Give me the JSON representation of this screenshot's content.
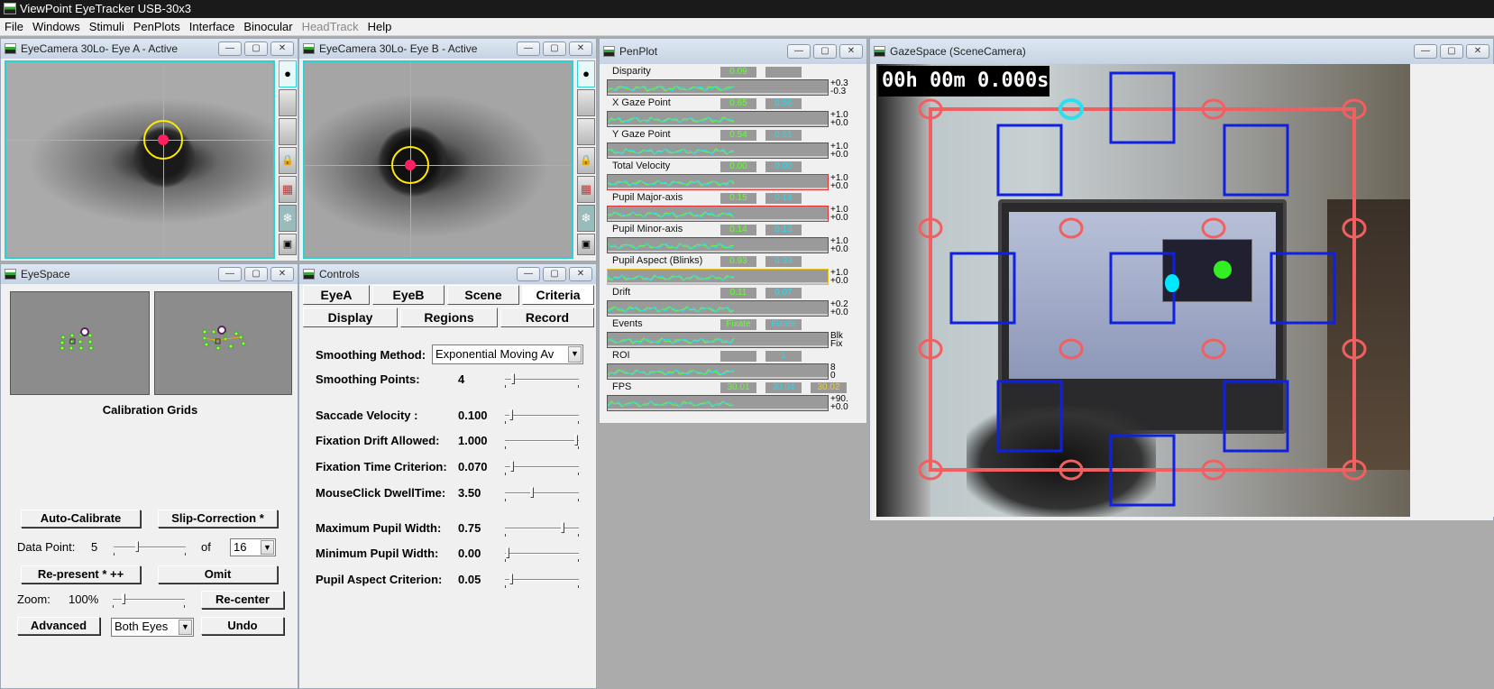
{
  "app": {
    "title": "ViewPoint EyeTracker USB-30x3"
  },
  "menu": [
    "File",
    "Windows",
    "Stimuli",
    "PenPlots",
    "Interface",
    "Binocular",
    "HeadTrack",
    "Help"
  ],
  "colors": {
    "cyan": "#29d3d3",
    "pink": "#ff7fd0",
    "calib_red": "#f06060",
    "roi_blue": "#1020e0",
    "green_trace": "#66ff33"
  },
  "eyecam_a": {
    "title": "EyeCamera 30Lo- Eye A - Active"
  },
  "eyecam_b": {
    "title": "EyeCamera 30Lo- Eye B - Active"
  },
  "eyespace": {
    "title": "EyeSpace",
    "caption": "Calibration Grids",
    "auto_calibrate": "Auto-Calibrate",
    "slip_correction": "Slip-Correction *",
    "data_point_label": "Data Point:",
    "data_point_value": "5",
    "of_label": "of",
    "of_value": "16",
    "represent": "Re-present * ++",
    "omit": "Omit",
    "zoom_label": "Zoom:",
    "zoom_value": "100%",
    "recenter": "Re-center",
    "advanced": "Advanced",
    "eyes_select": "Both Eyes",
    "undo": "Undo"
  },
  "controls": {
    "title": "Controls",
    "tabs_row1": [
      "EyeA",
      "EyeB",
      "Scene",
      "Criteria"
    ],
    "tabs_row2": [
      "Display",
      "Regions",
      "Record"
    ],
    "smoothing_method_label": "Smoothing Method:",
    "smoothing_method_value": "Exponential Moving Av",
    "params": [
      {
        "label": "Smoothing Points:",
        "value": "4",
        "level": 0.08
      },
      {
        "label": "Saccade Velocity :",
        "value": "0.100",
        "level": 0.05
      },
      {
        "label": "Fixation Drift Allowed:",
        "value": "1.000",
        "level": 1.0
      },
      {
        "label": "Fixation Time Criterion:",
        "value": "0.070",
        "level": 0.07
      },
      {
        "label": "MouseClick DwellTime:",
        "value": "3.50",
        "level": 0.35
      },
      {
        "label": "Maximum Pupil Width:",
        "value": "0.75",
        "level": 0.8
      },
      {
        "label": "Minimum Pupil Width:",
        "value": "0.00",
        "level": 0.0
      },
      {
        "label": "Pupil Aspect Criterion:",
        "value": "0.05",
        "level": 0.05
      }
    ]
  },
  "penplot": {
    "title": "PenPlot",
    "rows": [
      {
        "label": "Disparity",
        "a": "0.09",
        "b": "",
        "c": "",
        "top": "+0.3",
        "bottom": "-0.3",
        "border": "#555"
      },
      {
        "label": "X Gaze Point",
        "a": "0.65",
        "b": "0.56",
        "c": "",
        "top": "+1.0",
        "bottom": "+0.0",
        "border": "#555"
      },
      {
        "label": "Y Gaze Point",
        "a": "0.54",
        "b": "0.51",
        "c": "",
        "top": "+1.0",
        "bottom": "+0.0",
        "border": "#555"
      },
      {
        "label": "Total Velocity",
        "a": "0.00",
        "b": "0.00",
        "c": "",
        "top": "+1.0",
        "bottom": "+0.0",
        "border": "#e03030"
      },
      {
        "label": "Pupil Major-axis",
        "a": "0.15",
        "b": "0.14",
        "c": "",
        "top": "+1.0",
        "bottom": "+0.0",
        "border": "#e03030"
      },
      {
        "label": "Pupil Minor-axis",
        "a": "0.14",
        "b": "0.13",
        "c": "",
        "top": "+1.0",
        "bottom": "+0.0",
        "border": "#555"
      },
      {
        "label": "Pupil Aspect (Blinks)",
        "a": "0.93",
        "b": "0.93",
        "c": "",
        "top": "+1.0",
        "bottom": "+0.0",
        "border": "#e0c020"
      },
      {
        "label": "Drift",
        "a": "0.11",
        "b": "0.07",
        "c": "",
        "top": "+0.2",
        "bottom": "+0.0",
        "border": "#555"
      },
      {
        "label": "Events",
        "a": "Fixate",
        "b": "Fixate",
        "c": "",
        "top": "Blk",
        "bottom": "Fix",
        "border": "#555"
      },
      {
        "label": "ROI",
        "a": "",
        "b": "1",
        "c": "",
        "top": "8",
        "bottom": "0",
        "border": "#555"
      },
      {
        "label": "FPS",
        "a": "30.01",
        "b": "30.04",
        "c": "30.02",
        "top": "+90.",
        "bottom": "+0.0",
        "border": "#555"
      }
    ]
  },
  "gazespace": {
    "title": "GazeSpace (SceneCamera)",
    "timer": "00h 00m 0.000s"
  }
}
